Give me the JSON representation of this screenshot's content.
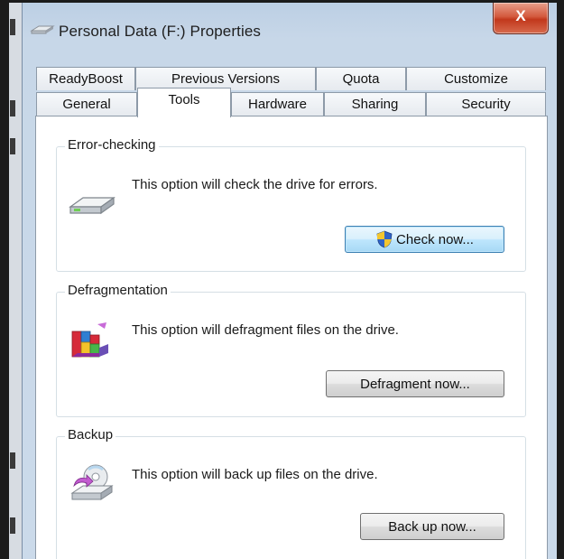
{
  "window": {
    "title": "Personal Data (F:) Properties",
    "close_glyph": "X"
  },
  "tabs_back": [
    "ReadyBoost",
    "Previous Versions",
    "Quota",
    "Customize"
  ],
  "tabs_front": [
    "General",
    "Tools",
    "Hardware",
    "Sharing",
    "Security"
  ],
  "active_tab": "Tools",
  "sections": {
    "error_checking": {
      "title": "Error-checking",
      "description": "This option will check the drive for errors.",
      "button": "Check now...",
      "icon": "drive-icon"
    },
    "defragmentation": {
      "title": "Defragmentation",
      "description": "This option will defragment files on the drive.",
      "button": "Defragment now...",
      "icon": "defragment-icon"
    },
    "backup": {
      "title": "Backup",
      "description": "This option will back up files on the drive.",
      "button": "Back up now...",
      "icon": "backup-icon"
    }
  },
  "colors": {
    "close_button": "#c7432a",
    "focus_button": "#bee6fd",
    "titlebar": "#c7d7e8"
  }
}
